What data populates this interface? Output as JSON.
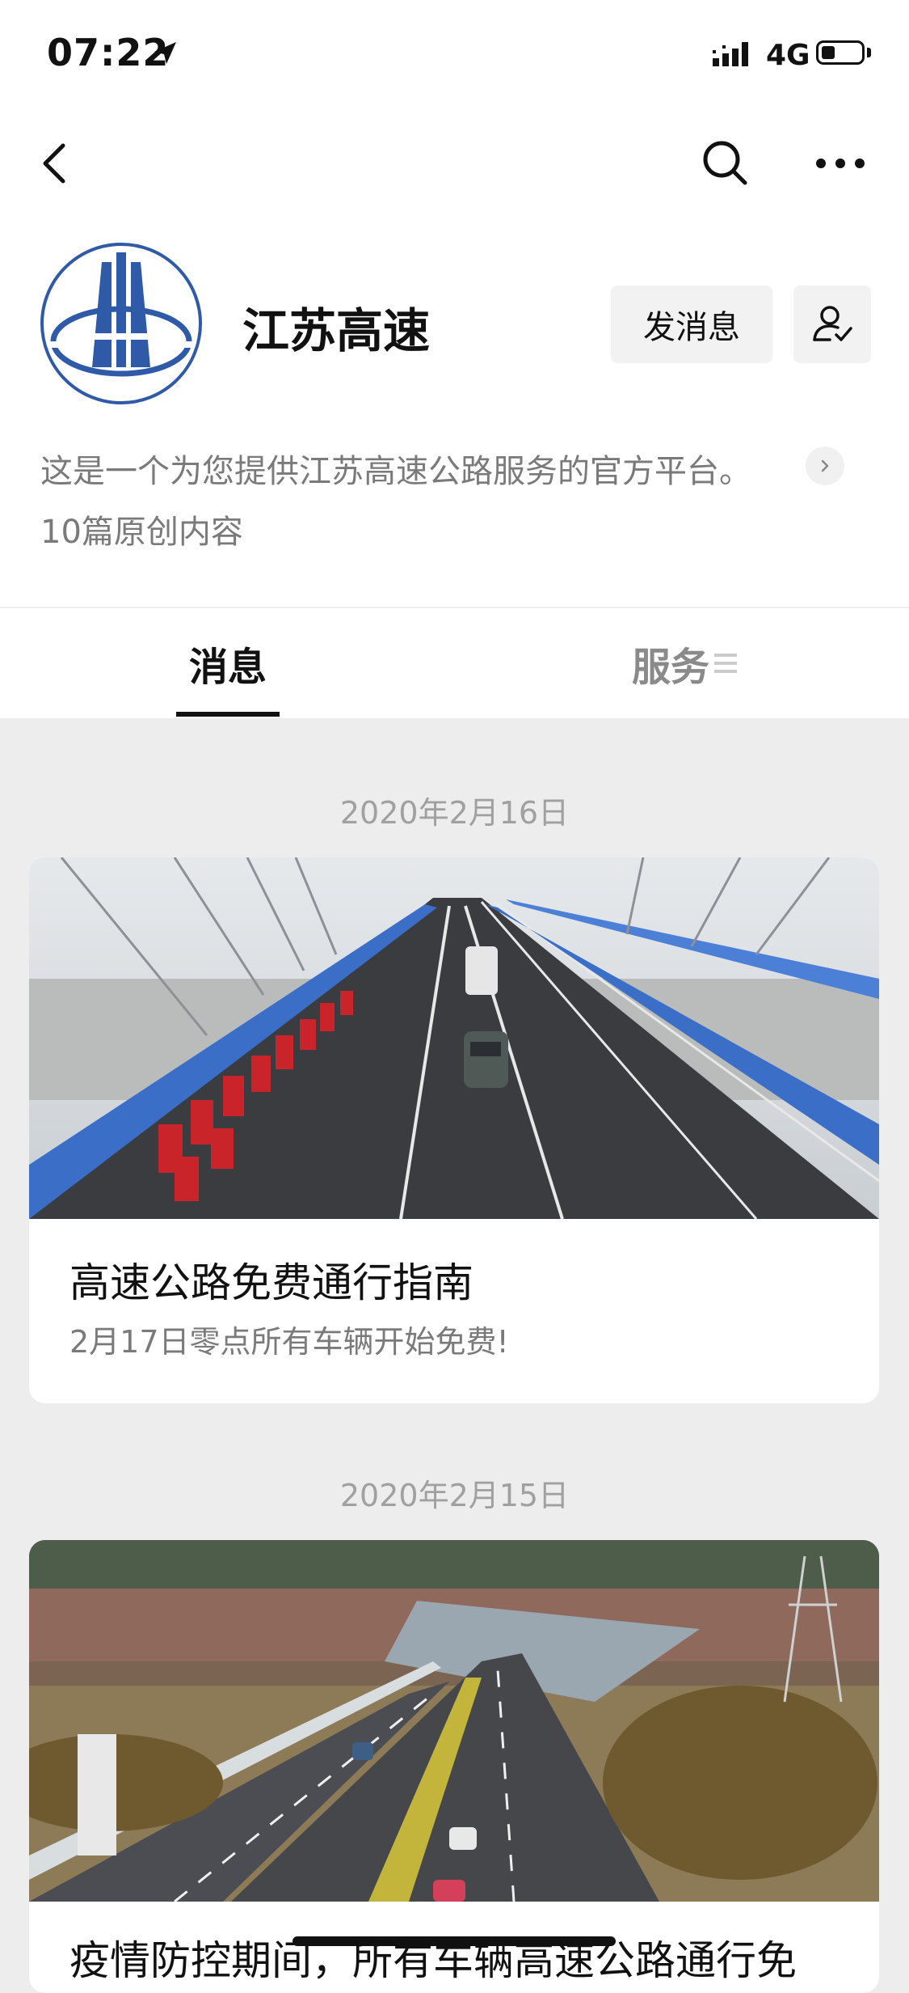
{
  "status_bar": {
    "time": "07:22",
    "network": "4G",
    "icons": [
      "location-arrow-icon",
      "signal-icon",
      "battery-icon"
    ]
  },
  "nav": {
    "icons": [
      "back-icon",
      "search-icon",
      "more-icon"
    ]
  },
  "profile": {
    "name": "江苏高速",
    "message_button": "发消息",
    "description": "这是一个为您提供江苏高速公路服务的官方平台。",
    "original_count": "10篇原创内容",
    "accent_color": "#2e5aa8"
  },
  "tabs": [
    {
      "label": "消息",
      "active": true
    },
    {
      "label": "服务",
      "active": false
    }
  ],
  "feed": [
    {
      "date": "2020年2月16日",
      "title": "高速公路免费通行指南",
      "subtitle": "2月17日零点所有车辆开始免费!"
    },
    {
      "date": "2020年2月15日",
      "title": "疫情防控期间，所有车辆高速公路通行免"
    }
  ]
}
